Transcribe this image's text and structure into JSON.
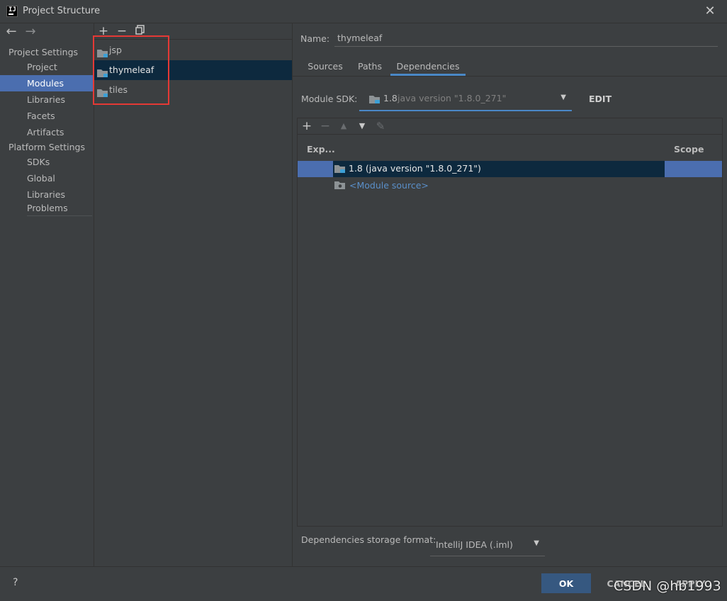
{
  "window": {
    "title": "Project Structure",
    "app_icon": "intellij-icon",
    "close_icon": "close-icon"
  },
  "nav": {
    "back_icon": "arrow-left-icon",
    "forward_icon": "arrow-right-icon",
    "project_settings_label": "Project Settings",
    "project_settings_items": [
      "Project",
      "Modules",
      "Libraries",
      "Facets",
      "Artifacts"
    ],
    "platform_settings_label": "Platform Settings",
    "platform_settings_items": [
      "SDKs",
      "Global Libraries"
    ],
    "problems_label": "Problems",
    "selected": "Modules"
  },
  "modules": {
    "toolbar": {
      "add": "+",
      "remove": "−"
    },
    "items": [
      "jsp",
      "thymeleaf",
      "tiles"
    ],
    "selected": "thymeleaf"
  },
  "detail": {
    "name_label": "Name:",
    "name_value": "thymeleaf",
    "tabs": [
      "Sources",
      "Paths",
      "Dependencies"
    ],
    "active_tab": "Dependencies",
    "module_sdk_label": "Module SDK:",
    "module_sdk_version": "1.8",
    "module_sdk_desc": "java version \"1.8.0_271\"",
    "edit_label": "EDIT",
    "dependencies": {
      "columns": {
        "export": "Exp...",
        "scope": "Scope"
      },
      "rows": [
        {
          "label": "1.8 (java version \"1.8.0_271\")",
          "selected": true
        },
        {
          "label": "<Module source>",
          "selected": false
        }
      ]
    },
    "storage_format_label": "Dependencies storage format:",
    "storage_format_value": "IntelliJ IDEA (.iml)"
  },
  "footer": {
    "help": "?",
    "ok": "OK",
    "cancel": "CANCEL",
    "apply": "APPLY"
  },
  "watermark": "CSDN @hb1993",
  "colors": {
    "background": "#3c3f41",
    "selection": "#4b6eaf",
    "selection_dark": "#0d293e",
    "accent": "#4a88c7",
    "highlight_box": "#e53935",
    "ok_button": "#365880"
  }
}
